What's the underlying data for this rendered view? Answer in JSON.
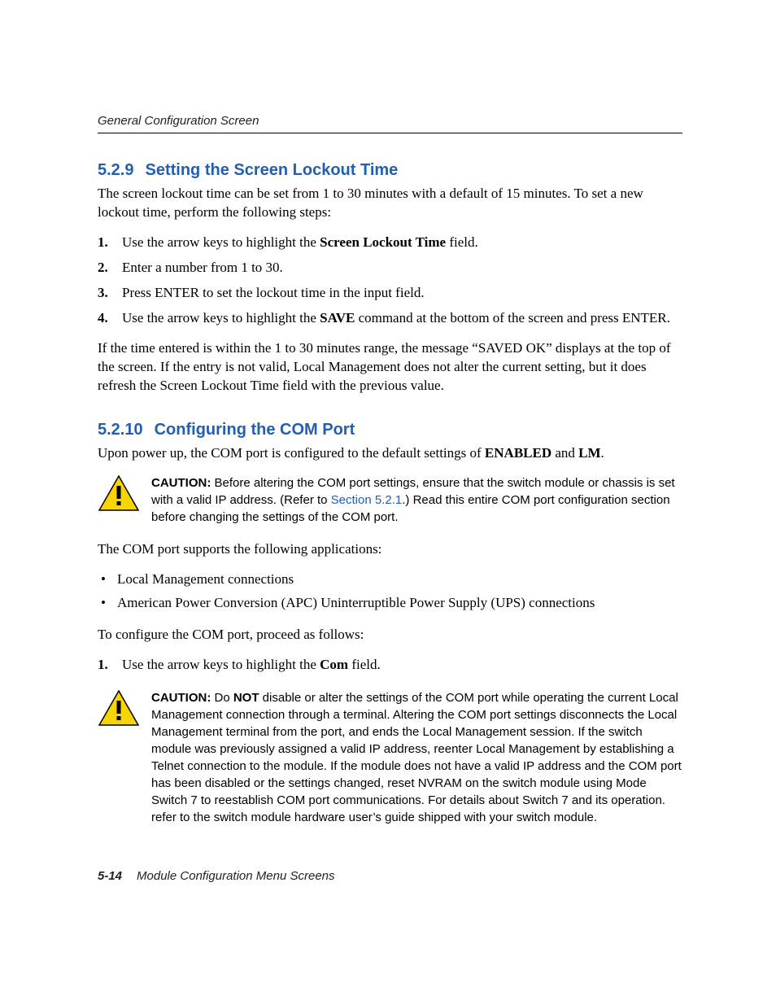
{
  "header": {
    "running_head": "General Configuration Screen"
  },
  "sec1": {
    "number": "5.2.9",
    "title": "Setting the Screen Lockout Time",
    "intro_a": "The screen lockout time can be set from 1 to 30 minutes with a default of 15 minutes. To set a new lockout time, perform the following steps:",
    "step1_a": "Use the arrow keys to highlight the ",
    "step1_b": "Screen Lockout Time",
    "step1_c": " field.",
    "step2": "Enter a number from 1 to 30.",
    "step3": "Press ENTER to set the lockout time in the input field.",
    "step4_a": "Use the arrow keys to highlight the ",
    "step4_b": "SAVE",
    "step4_c": " command at the bottom of the screen and press ENTER.",
    "outro": "If the time entered is within the 1 to 30 minutes range, the message “SAVED OK” displays at the top of the screen. If the entry is not valid, Local Management does not alter the current setting, but it does refresh the Screen Lockout Time field with the previous value."
  },
  "sec2": {
    "number": "5.2.10",
    "title": "Configuring the COM Port",
    "intro_a": "Upon power up, the COM port is configured to the default settings of ",
    "intro_b": "ENABLED",
    "intro_c": " and ",
    "intro_d": "LM",
    "intro_e": ".",
    "caution1_label": "CAUTION:",
    "caution1_a": "  Before altering the COM port settings, ensure that the switch module or chassis is set with a valid IP address. (Refer to ",
    "caution1_link": "Section 5.2.1",
    "caution1_b": ".) Read this entire COM port configuration section before changing the settings of the COM port.",
    "supports": "The COM port supports the following applications:",
    "bullet1": "Local Management connections",
    "bullet2": "American Power Conversion (APC) Uninterruptible Power Supply (UPS) connections",
    "config_intro": "To configure the COM port, proceed as follows:",
    "cstep1_a": "Use the arrow keys to highlight the ",
    "cstep1_b": "Com",
    "cstep1_c": " field.",
    "caution2_label": "CAUTION:",
    "caution2_a": "  Do ",
    "caution2_not": "NOT",
    "caution2_b": " disable or alter the settings of the COM port while operating the current Local Management connection through a terminal. Altering the COM port settings disconnects the Local Management terminal from the port, and ends the Local Management session. If the switch module was previously assigned a valid IP address, reenter Local Management by establishing a Telnet connection to the module. If the module does not have a valid IP address and the COM port has been disabled or the settings changed, reset NVRAM on the switch module using Mode Switch 7 to reestablish COM port communications. For details about Switch 7 and its operation. refer to the switch module hardware user’s guide shipped with your switch module."
  },
  "footer": {
    "page": "5-14",
    "title": "Module Configuration Menu Screens"
  },
  "icons": {
    "caution_alt": "caution-icon"
  }
}
